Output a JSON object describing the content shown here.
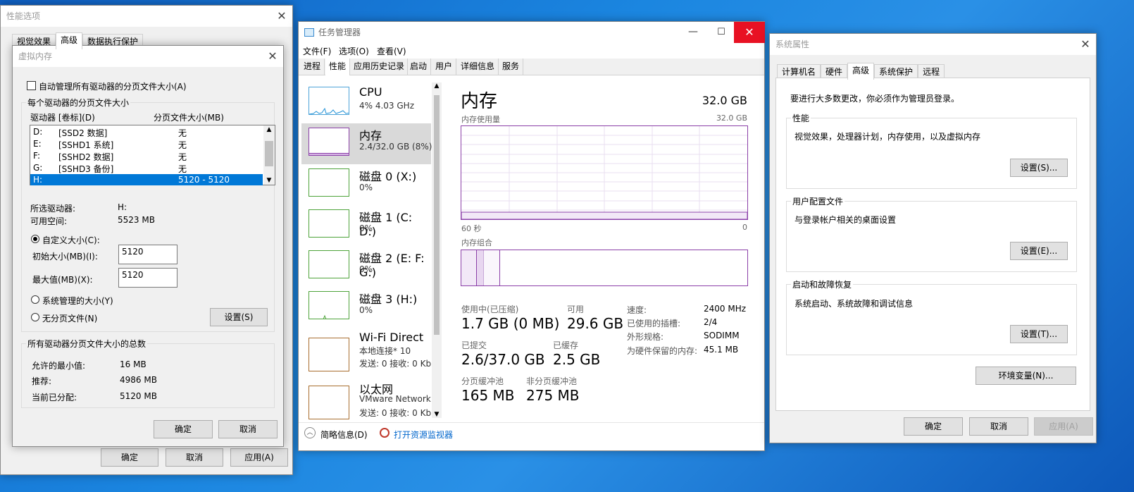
{
  "perf_options": {
    "title": "性能选项",
    "tabs": [
      "视觉效果",
      "高级",
      "数据执行保护"
    ],
    "ok": "确定",
    "cancel": "取消",
    "apply": "应用(A)"
  },
  "vmem": {
    "title": "虚拟内存",
    "auto_manage": "自动管理所有驱动器的分页文件大小(A)",
    "group_title": "每个驱动器的分页文件大小",
    "col_drive": "驱动器 [卷标](D)",
    "col_size": "分页文件大小(MB)",
    "drives": [
      {
        "d": "D:",
        "label": "[SSD2 数据]",
        "size": "无"
      },
      {
        "d": "E:",
        "label": "[SSHD1 系统]",
        "size": "无"
      },
      {
        "d": "F:",
        "label": "[SSHD2 数据]",
        "size": "无"
      },
      {
        "d": "G:",
        "label": "[SSHD3 备份]",
        "size": "无"
      },
      {
        "d": "H:",
        "label": "",
        "size": "5120 - 5120"
      }
    ],
    "sel_drive_label": "所选驱动器:",
    "sel_drive": "H:",
    "free_label": "可用空间:",
    "free": "5523 MB",
    "custom": "自定义大小(C):",
    "initial_label": "初始大小(MB)(I):",
    "initial": "5120",
    "max_label": "最大值(MB)(X):",
    "max": "5120",
    "sys_managed": "系统管理的大小(Y)",
    "no_paging": "无分页文件(N)",
    "set": "设置(S)",
    "total_title": "所有驱动器分页文件大小的总数",
    "min_label": "允许的最小值:",
    "min": "16 MB",
    "rec_label": "推荐:",
    "rec": "4986 MB",
    "cur_label": "当前已分配:",
    "cur": "5120 MB",
    "ok": "确定",
    "cancel": "取消"
  },
  "taskmgr": {
    "title": "任务管理器",
    "menu": [
      "文件(F)",
      "选项(O)",
      "查看(V)"
    ],
    "tabs": [
      "进程",
      "性能",
      "应用历史记录",
      "启动",
      "用户",
      "详细信息",
      "服务"
    ],
    "side": [
      {
        "name": "CPU",
        "sub": "4% 4.03 GHz"
      },
      {
        "name": "内存",
        "sub": "2.4/32.0 GB (8%)"
      },
      {
        "name": "磁盘 0 (X:)",
        "sub": "0%"
      },
      {
        "name": "磁盘 1 (C: D:)",
        "sub": "0%"
      },
      {
        "name": "磁盘 2 (E: F: G:)",
        "sub": "0%"
      },
      {
        "name": "磁盘 3 (H:)",
        "sub": "0%"
      },
      {
        "name": "Wi-Fi Direct",
        "sub": "本地连接* 10",
        "sub2": "发送: 0 接收: 0 Kbps"
      },
      {
        "name": "以太网",
        "sub": "VMware Network ...",
        "sub2": "发送: 0 接收: 0 Kbps"
      }
    ],
    "heading": "内存",
    "total": "32.0 GB",
    "usage_label": "内存使用量",
    "usage_max": "32.0 GB",
    "time_left": "60 秒",
    "time_right": "0",
    "composition": "内存组合",
    "in_use_label": "使用中(已压缩)",
    "in_use": "1.7 GB (0 MB)",
    "avail_label": "可用",
    "avail": "29.6 GB",
    "commit_label": "已提交",
    "commit": "2.6/37.0 GB",
    "cached_label": "已缓存",
    "cached": "2.5 GB",
    "paged_label": "分页缓冲池",
    "paged": "165 MB",
    "nonpaged_label": "非分页缓冲池",
    "nonpaged": "275 MB",
    "speed_label": "速度:",
    "speed": "2400 MHz",
    "slots_label": "已使用的插槽:",
    "slots": "2/4",
    "form_label": "外形规格:",
    "form": "SODIMM",
    "reserved_label": "为硬件保留的内存:",
    "reserved": "45.1 MB",
    "fewer": "简略信息(D)",
    "resmon": "打开资源监视器",
    "accent": "#8b3fa8",
    "close_color": "#e81123"
  },
  "sysprops": {
    "title": "系统属性",
    "tabs": [
      "计算机名",
      "硬件",
      "高级",
      "系统保护",
      "远程"
    ],
    "admin_note": "要进行大多数更改，你必须作为管理员登录。",
    "perf_title": "性能",
    "perf_desc": "视觉效果，处理器计划，内存使用，以及虚拟内存",
    "perf_btn": "设置(S)...",
    "profile_title": "用户配置文件",
    "profile_desc": "与登录帐户相关的桌面设置",
    "profile_btn": "设置(E)...",
    "startup_title": "启动和故障恢复",
    "startup_desc": "系统启动、系统故障和调试信息",
    "startup_btn": "设置(T)...",
    "env_btn": "环境变量(N)...",
    "ok": "确定",
    "cancel": "取消",
    "apply": "应用(A)"
  }
}
